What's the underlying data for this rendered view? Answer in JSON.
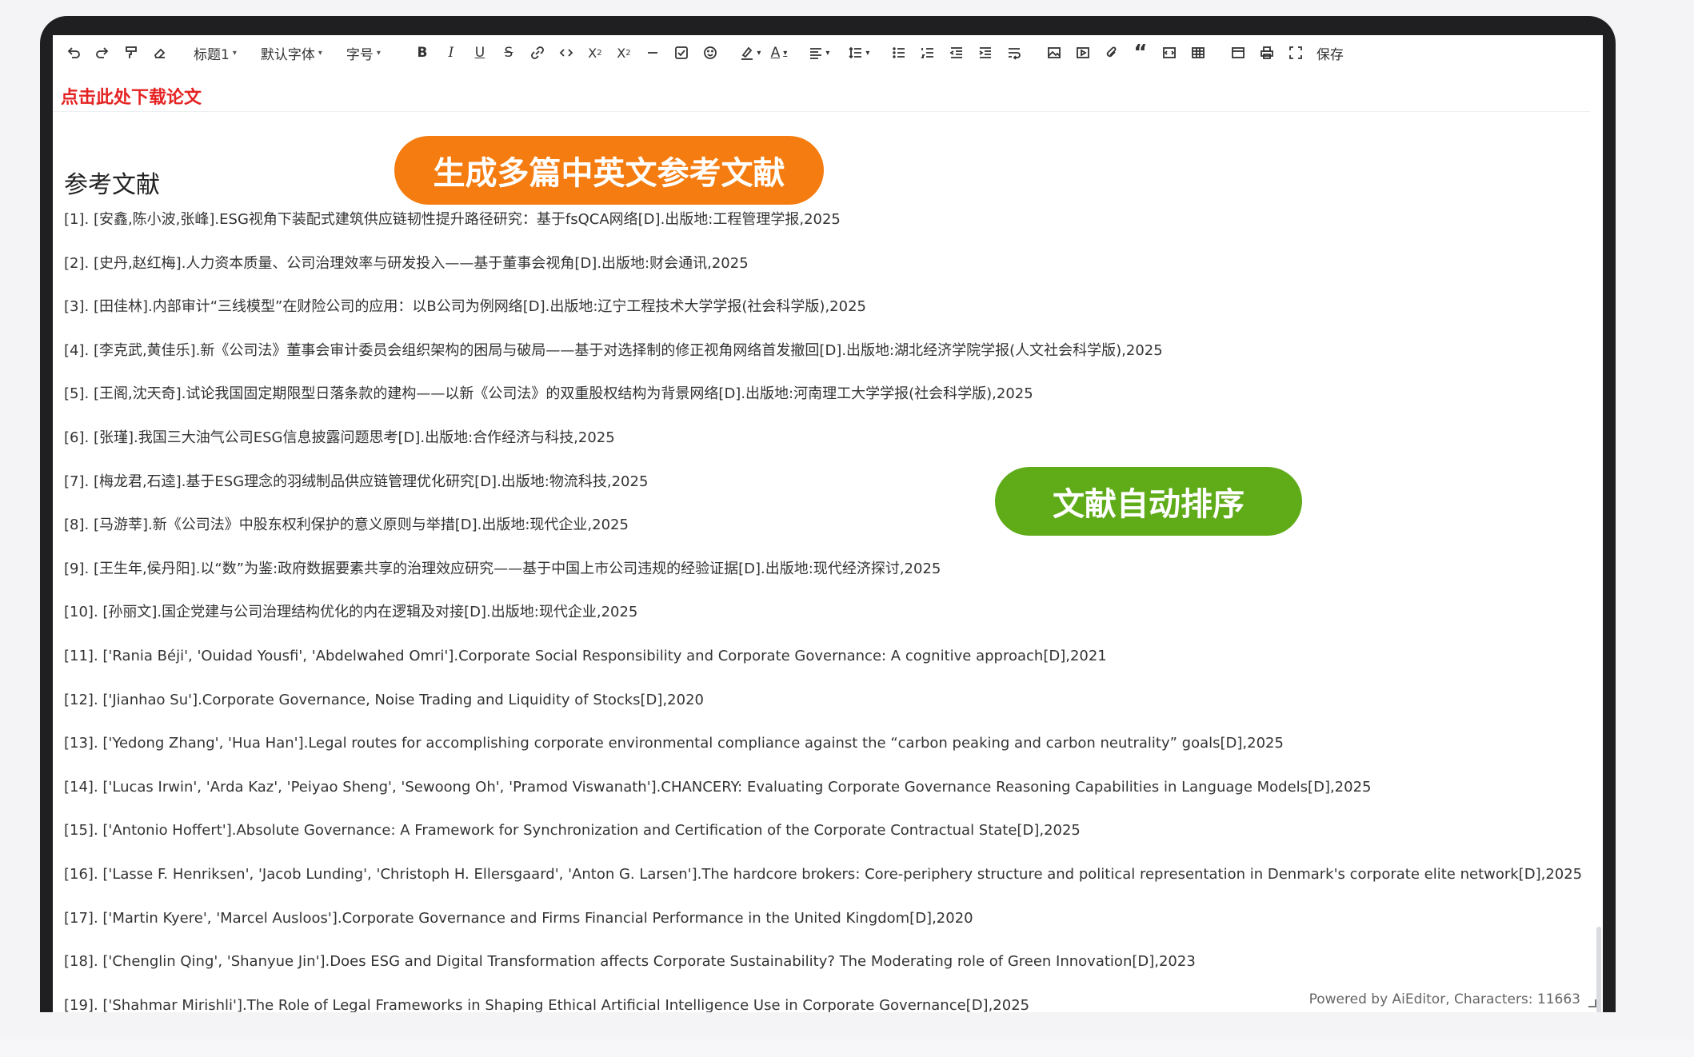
{
  "toolbar": {
    "heading_label": "标题1",
    "font_family_label": "默认字体",
    "font_size_label": "字号",
    "save_label": "保存"
  },
  "download_link": "点击此处下载论文",
  "badges": {
    "generate": "生成多篇中英文参考文献",
    "sort": "文献自动排序"
  },
  "references": {
    "heading": "参考文献",
    "items": [
      "[1]. [安鑫,陈小波,张峰].ESG视角下装配式建筑供应链韧性提升路径研究：基于fsQCA网络[D].出版地:工程管理学报,2025",
      "[2]. [史丹,赵红梅].人力资本质量、公司治理效率与研发投入——基于董事会视角[D].出版地:财会通讯,2025",
      "[3]. [田佳林].内部审计“三线模型”在财险公司的应用：以B公司为例网络[D].出版地:辽宁工程技术大学学报(社会科学版),2025",
      "[4]. [李克武,黄佳乐].新《公司法》董事会审计委员会组织架构的困局与破局——基于对选择制的修正视角网络首发撤回[D].出版地:湖北经济学院学报(人文社会科学版),2025",
      "[5]. [王阁,沈天奇].试论我国固定期限型日落条款的建构——以新《公司法》的双重股权结构为背景网络[D].出版地:河南理工大学学报(社会科学版),2025",
      "[6]. [张瑾].我国三大油气公司ESG信息披露问题思考[D].出版地:合作经济与科技,2025",
      "[7]. [梅龙君,石逵].基于ESG理念的羽绒制品供应链管理优化研究[D].出版地:物流科技,2025",
      "[8]. [马游莘].新《公司法》中股东权利保护的意义原则与举措[D].出版地:现代企业,2025",
      "[9]. [王生年,侯丹阳].以“数”为鉴:政府数据要素共享的治理效应研究——基于中国上市公司违规的经验证据[D].出版地:现代经济探讨,2025",
      "[10]. [孙丽文].国企党建与公司治理结构优化的内在逻辑及对接[D].出版地:现代企业,2025",
      "[11]. ['Rania Béji', 'Ouidad Yousfi', 'Abdelwahed Omri'].Corporate Social Responsibility and Corporate Governance: A cognitive approach[D],2021",
      "[12]. ['Jianhao Su'].Corporate Governance, Noise Trading and Liquidity of Stocks[D],2020",
      "[13]. ['Yedong Zhang', 'Hua Han'].Legal routes for accomplishing corporate environmental compliance against the “carbon peaking and carbon neutrality” goals[D],2025",
      "[14]. ['Lucas Irwin', 'Arda Kaz', 'Peiyao Sheng', 'Sewoong Oh', 'Pramod Viswanath'].CHANCERY: Evaluating Corporate Governance Reasoning Capabilities in Language Models[D],2025",
      "[15]. ['Antonio Hoffert'].Absolute Governance: A Framework for Synchronization and Certification of the Corporate Contractual State[D],2025",
      "[16]. ['Lasse F. Henriksen', 'Jacob Lunding', 'Christoph H. Ellersgaard', 'Anton G. Larsen'].The hardcore brokers: Core-periphery structure and political representation in Denmark's corporate elite network[D],2025",
      "[17]. ['Martin Kyere', 'Marcel Ausloos'].Corporate Governance and Firms Financial Performance in the United Kingdom[D],2020",
      "[18]. ['Chenglin Qing', 'Shanyue Jin'].Does ESG and Digital Transformation affects Corporate Sustainability? The Moderating role of Green Innovation[D],2023",
      "[19]. ['Shahmar Mirishli'].The Role of Legal Frameworks in Shaping Ethical Artificial Intelligence Use in Corporate Governance[D],2025"
    ]
  },
  "status": "Powered by AiEditor, Characters: 11663",
  "colors": {
    "link_red": "#e52222",
    "badge_orange": "#f57c10",
    "badge_green": "#5fab18",
    "frame": "#1f1f22"
  }
}
